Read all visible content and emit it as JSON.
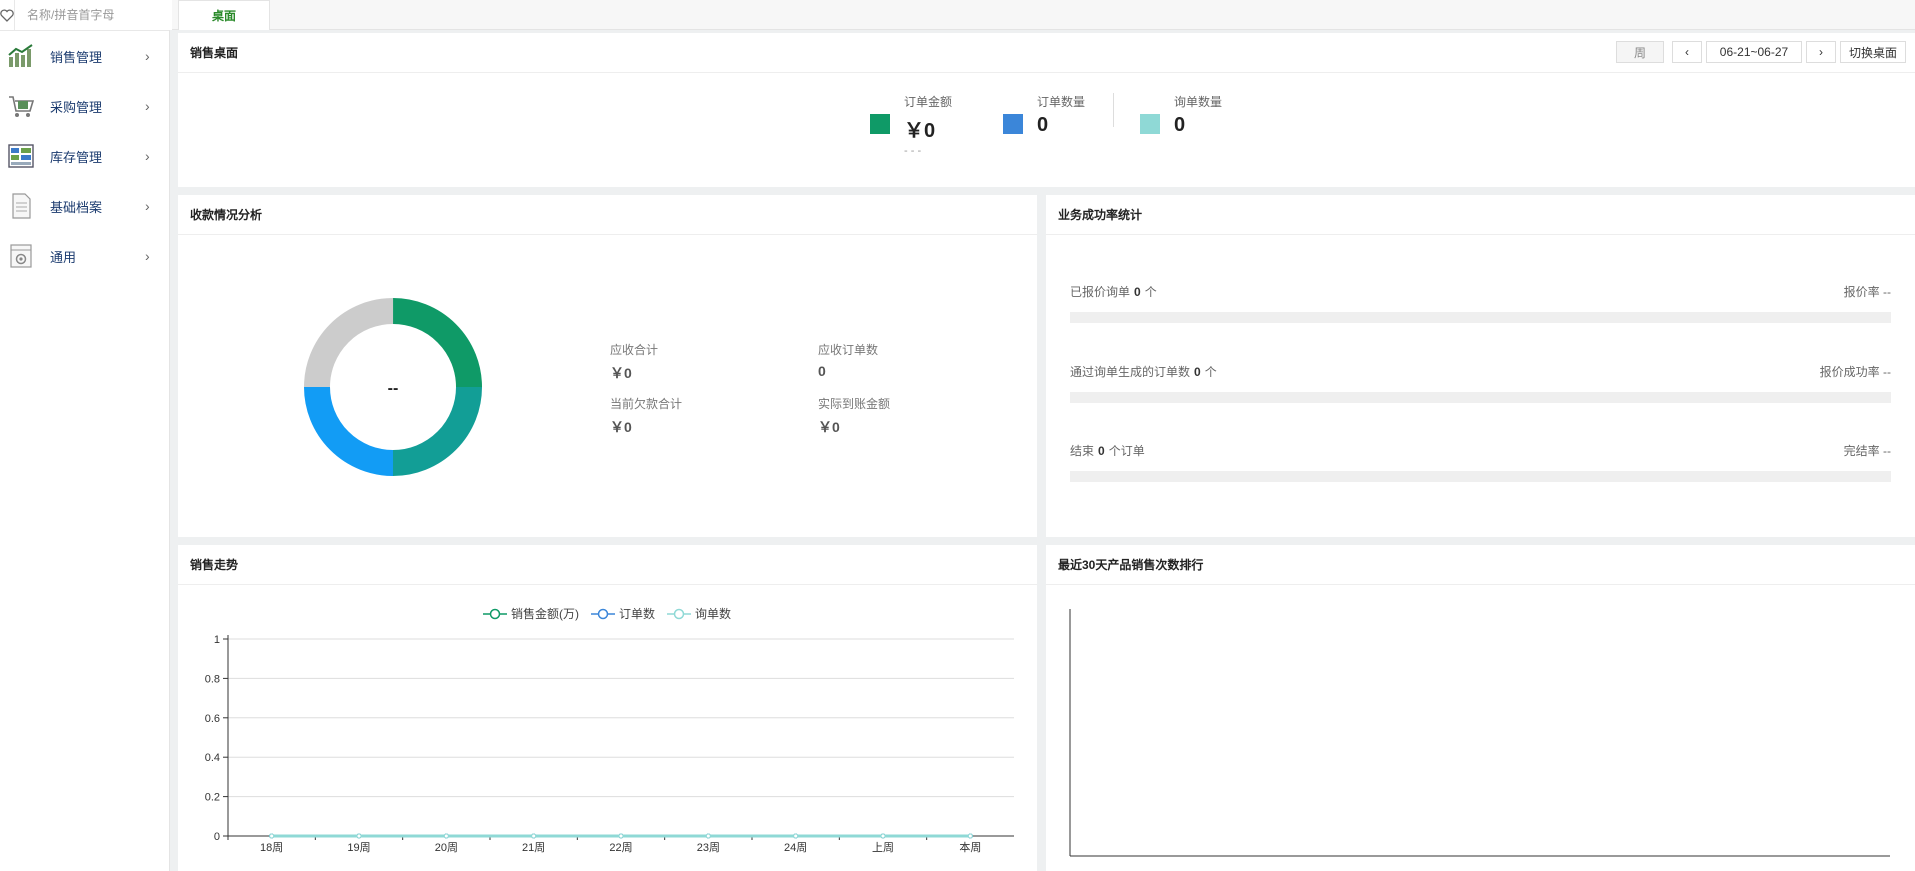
{
  "sidebar": {
    "search_placeholder": "名称/拼音首字母",
    "items": [
      {
        "label": "销售管理",
        "icon": "sales-chart-icon"
      },
      {
        "label": "采购管理",
        "icon": "cart-icon"
      },
      {
        "label": "库存管理",
        "icon": "inventory-icon"
      },
      {
        "label": "基础档案",
        "icon": "document-icon"
      },
      {
        "label": "通用",
        "icon": "settings-icon"
      }
    ]
  },
  "tabs": {
    "active": "桌面"
  },
  "sales_desk": {
    "title": "销售桌面",
    "period_btn": "周",
    "date_range": "06-21~06-27",
    "switch_btn": "切换桌面",
    "stats": [
      {
        "label": "订单金额",
        "value": "￥0",
        "sub": "- - -",
        "color": "#0f9a67"
      },
      {
        "label": "订单数量",
        "value": "0",
        "color": "#3b86d9"
      },
      {
        "label": "询单数量",
        "value": "0",
        "color": "#8fd9d6"
      }
    ]
  },
  "receipt": {
    "title": "收款情况分析",
    "center": "--",
    "items": [
      {
        "label": "应收合计",
        "value": "￥0"
      },
      {
        "label": "应收订单数",
        "value": "0"
      },
      {
        "label": "当前欠款合计",
        "value": "￥0"
      },
      {
        "label": "实际到账金额",
        "value": "￥0"
      }
    ],
    "donut_colors": [
      "#0f9a67",
      "#129e96",
      "#129cf5",
      "#cccccc"
    ]
  },
  "biz": {
    "title": "业务成功率统计",
    "rows": [
      {
        "prefix": "已报价询单",
        "count": "0",
        "suffix": "个",
        "rate_label": "报价率",
        "rate": "--"
      },
      {
        "prefix": "通过询单生成的订单数",
        "count": "0",
        "suffix": "个",
        "rate_label": "报价成功率",
        "rate": "--"
      },
      {
        "prefix": "结束",
        "count": "0",
        "suffix": "个订单",
        "rate_label": "完结率",
        "rate": "--"
      }
    ]
  },
  "trend": {
    "title": "销售走势",
    "legend": [
      "销售金额(万)",
      "订单数",
      "询单数"
    ],
    "colors": [
      "#0f9a67",
      "#3b86d9",
      "#8fd9d6"
    ]
  },
  "ranking": {
    "title": "最近30天产品销售次数排行"
  },
  "chart_data": {
    "type": "line",
    "categories": [
      "18周",
      "19周",
      "20周",
      "21周",
      "22周",
      "23周",
      "24周",
      "上周",
      "本周"
    ],
    "series": [
      {
        "name": "销售金额(万)",
        "values": [
          0,
          0,
          0,
          0,
          0,
          0,
          0,
          0,
          0
        ]
      },
      {
        "name": "订单数",
        "values": [
          0,
          0,
          0,
          0,
          0,
          0,
          0,
          0,
          0
        ]
      },
      {
        "name": "询单数",
        "values": [
          0,
          0,
          0,
          0,
          0,
          0,
          0,
          0,
          0
        ]
      }
    ],
    "yticks": [
      "0",
      "0.2",
      "0.4",
      "0.6",
      "0.8",
      "1"
    ],
    "ylim": [
      0,
      1
    ],
    "grid": true,
    "legend": "top-center"
  }
}
